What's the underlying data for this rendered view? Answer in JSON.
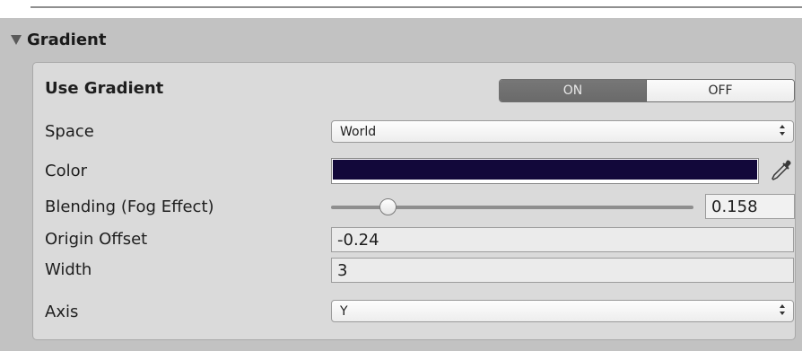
{
  "section": {
    "title": "Gradient"
  },
  "fields": {
    "use_gradient": {
      "label": "Use Gradient",
      "on_label": "ON",
      "off_label": "OFF",
      "state": "on"
    },
    "space": {
      "label": "Space",
      "value": "World"
    },
    "color": {
      "label": "Color",
      "value": "#12083a"
    },
    "blending": {
      "label": "Blending (Fog Effect)",
      "value": "0.158",
      "slider_fraction": 0.158
    },
    "origin_offset": {
      "label": "Origin Offset",
      "value": "-0.24"
    },
    "width": {
      "label": "Width",
      "value": "3"
    },
    "axis": {
      "label": "Axis",
      "value": "Y"
    }
  },
  "icons": {
    "foldout": "triangle-down-icon",
    "dropdown": "up-down-arrows-icon",
    "picker": "eyedropper-icon"
  },
  "colors": {
    "toggle_on": "#707070",
    "panel": "#c2c2c2",
    "inner": "#dadada"
  }
}
